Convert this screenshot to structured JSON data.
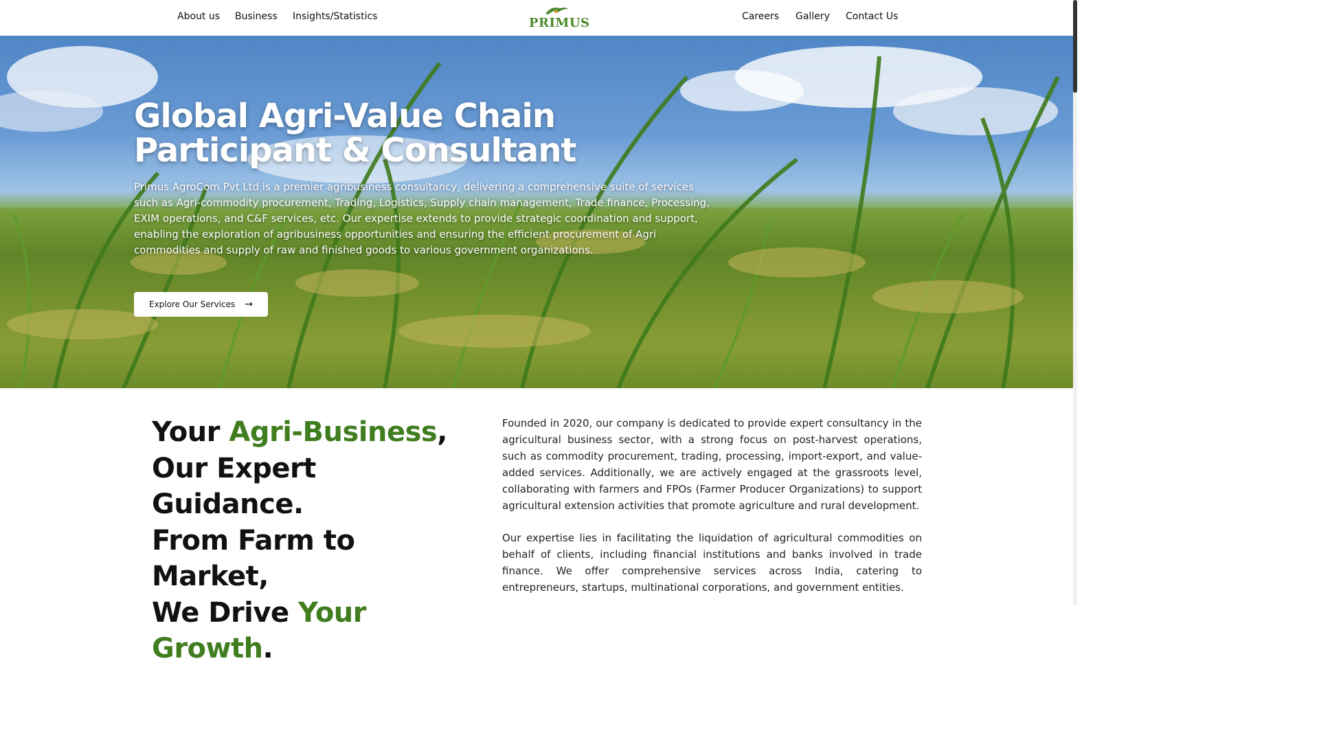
{
  "nav": {
    "left": [
      "About us",
      "Business",
      "Insights/Statistics"
    ],
    "right": [
      "Careers",
      "Gallery",
      "Contact Us"
    ],
    "logo_text": "PRIMUS"
  },
  "hero": {
    "title_line1": "Global Agri-Value Chain",
    "title_line2": "Participant & Consultant",
    "description": "Primus AgroCom Pvt Ltd is a premier agribusiness consultancy, delivering a comprehensive suite of services such as Agri-commodity procurement, Trading, Logistics, Supply chain management, Trade finance, Processing, EXIM operations, and C&F services, etc. Our expertise extends to provide strategic coordination and support, enabling the exploration of agribusiness opportunities and ensuring the efficient procurement of Agri commodities and supply of raw and finished goods to various government organizations.",
    "button_label": "Explore Our Services",
    "button_icon": "arrow-right-icon"
  },
  "about": {
    "tagline": {
      "l1_a": "Your ",
      "l1_b": "Agri-Business",
      "l1_c": ",",
      "l2": "Our Expert Guidance.",
      "l3": "From Farm to Market,",
      "l4_a": "We Drive ",
      "l4_b": "Your Growth",
      "l4_c": "."
    },
    "paragraph1": "Founded in 2020, our company is dedicated to provide expert consultancy in the agricultural business sector, with a strong focus on post-harvest operations, such as commodity procurement, trading, processing, import-export, and value-added services. Additionally, we are actively engaged at the grassroots level, collaborating with farmers and FPOs (Farmer Producer Organizations) to support agricultural extension activities that promote agriculture and rural development.",
    "paragraph2": "Our expertise lies in facilitating the liquidation of agricultural commodities on behalf of clients, including financial institutions and banks involved in trade finance. We offer comprehensive services across India, catering to entrepreneurs, startups, multinational corporations, and government entities."
  },
  "colors": {
    "accent_green": "#3f7d1f",
    "logo_green": "#4a8a2a",
    "logo_orange": "#e08a1e"
  }
}
